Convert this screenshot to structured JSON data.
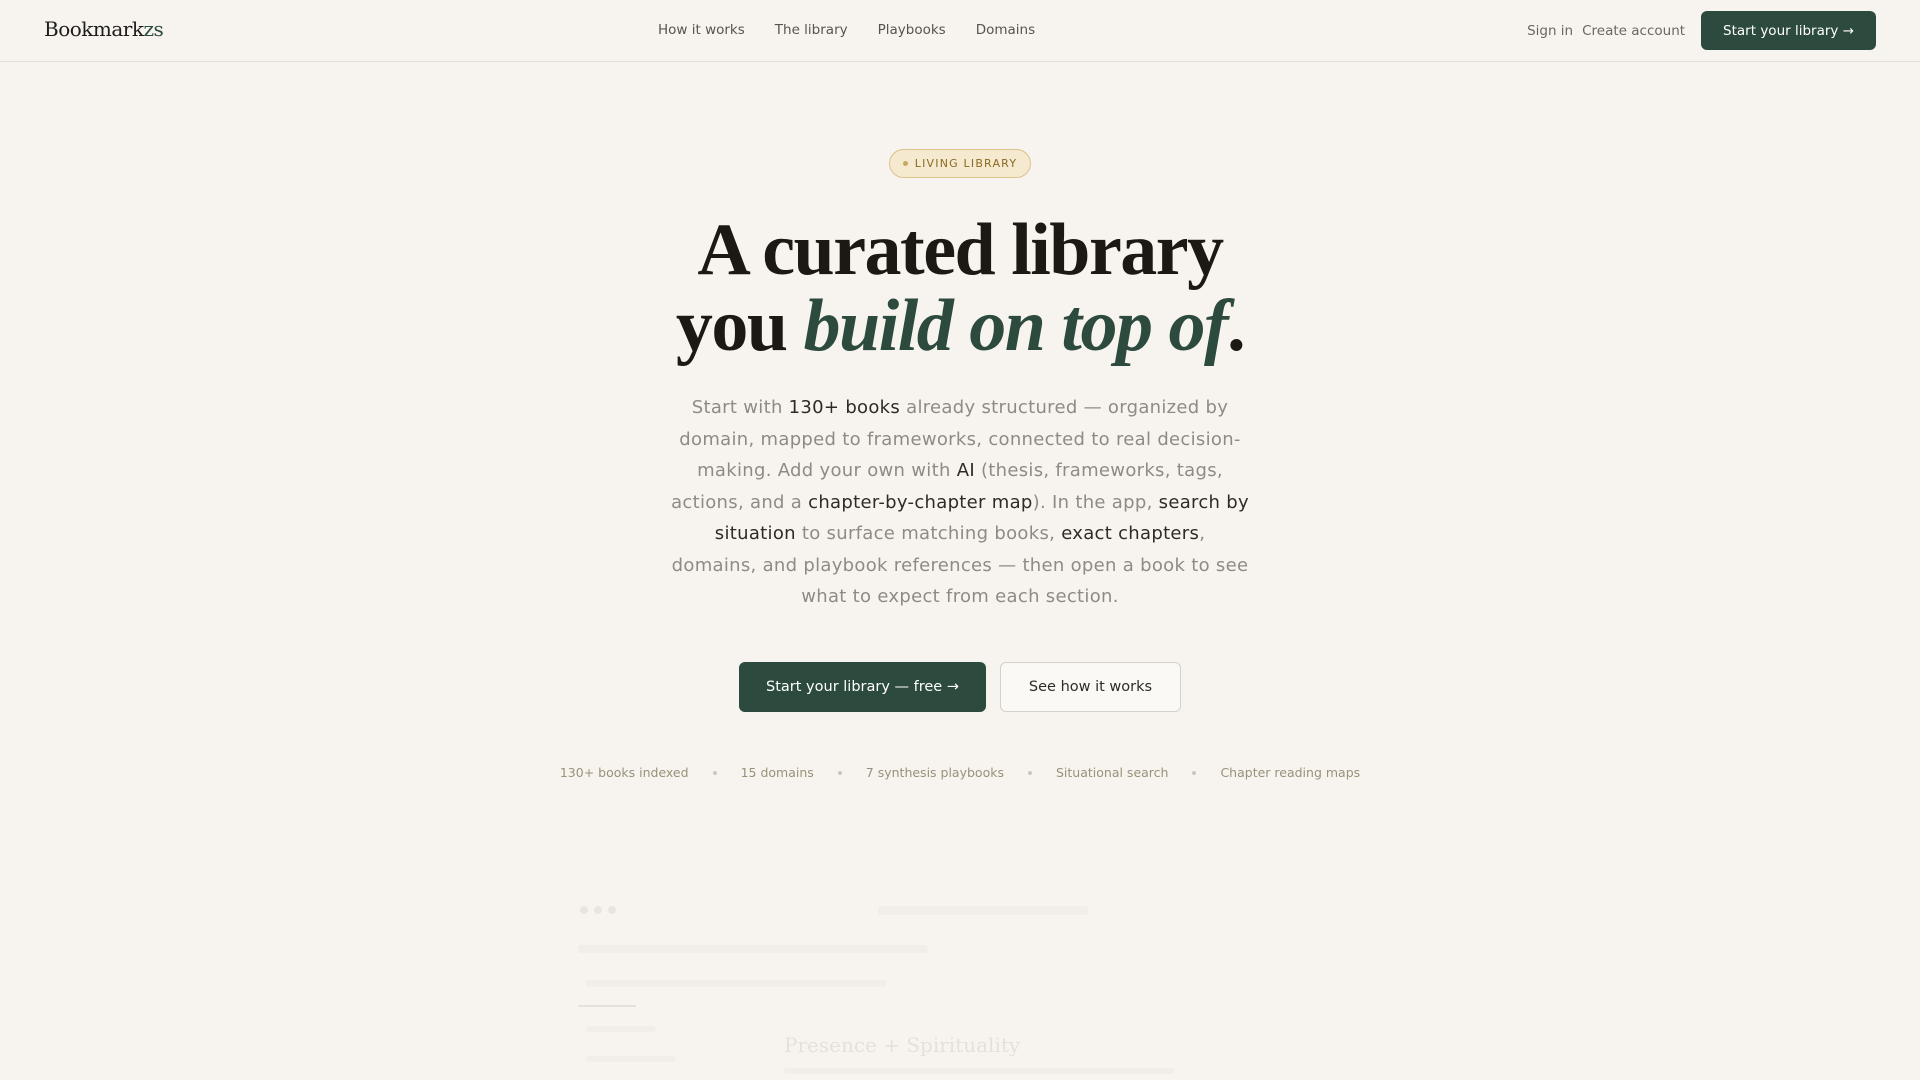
{
  "nav": {
    "logo_main": "Bookmark",
    "logo_accent": "zs",
    "links": [
      "How it works",
      "The library",
      "Playbooks",
      "Domains"
    ],
    "sign_in": "Sign in",
    "create_account": "Create account",
    "cta": "Start your library →"
  },
  "hero": {
    "badge": "LIVING LIBRARY",
    "headline_line1": "A curated library",
    "headline_you": "you ",
    "headline_emph": "build on top of",
    "headline_end": ".",
    "sub": {
      "t1": "Start with ",
      "b1": "130+ books",
      "t2": " already structured — organized by domain, mapped to frameworks, connected to real decision-making. Add your own with ",
      "b2": "AI",
      "t3": " (thesis, frameworks, tags, actions, and a ",
      "b3": "chapter-by-chapter map",
      "t4": "). In the app, ",
      "b4": "search by situation",
      "t5": " to surface matching books, ",
      "b5": "exact chapters",
      "t6": ", domains, and playbook references — then open a book to see what to expect from each section."
    },
    "cta_primary": "Start your library — free →",
    "cta_secondary": "See how it works"
  },
  "stats": [
    "130+ books indexed",
    "15 domains",
    "7 synthesis playbooks",
    "Situational search",
    "Chapter reading maps"
  ],
  "preview": {
    "title": "Presence + Spirituality"
  },
  "colors": {
    "accent": "#2c4a3e",
    "background": "#f7f4ef",
    "badge": "#f5ead0"
  }
}
